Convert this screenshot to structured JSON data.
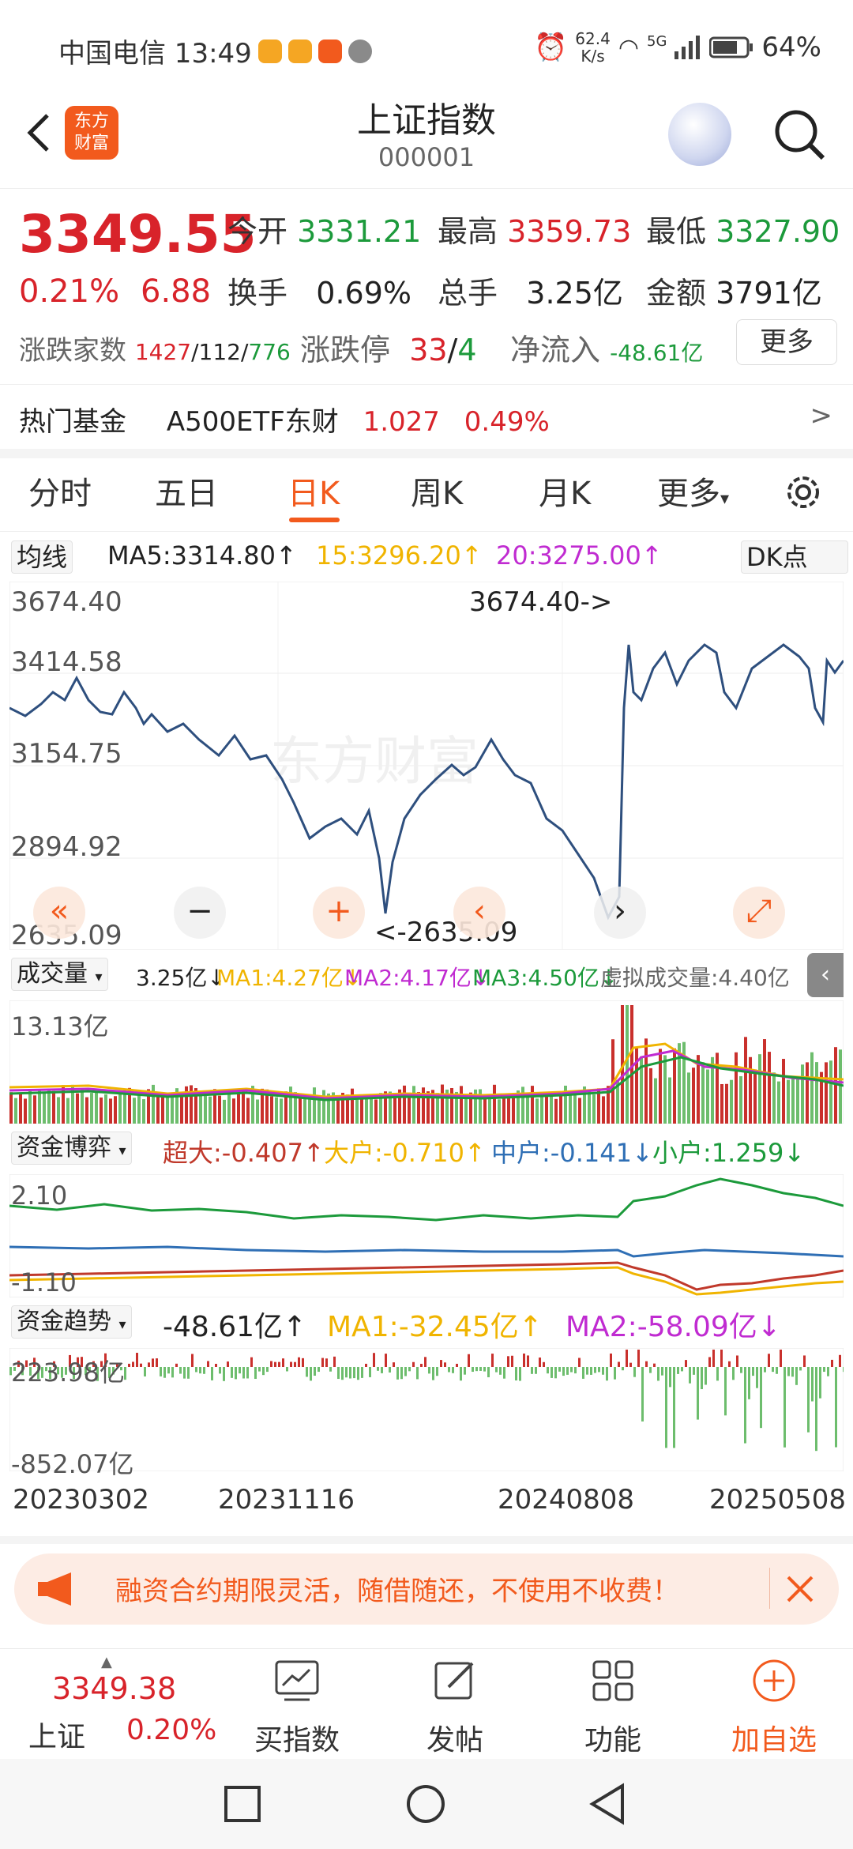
{
  "status_bar": {
    "carrier_time": "中国电信 13:49",
    "net_speed_value": "62.4",
    "net_speed_unit": "K/s",
    "signal": "5G",
    "battery": "64%"
  },
  "header": {
    "logo_line1": "东方",
    "logo_line2": "财富",
    "title": "上证指数",
    "code": "000001"
  },
  "quote": {
    "price": "3349.55",
    "change_pct": "0.21%",
    "change_val": "6.88",
    "open_label": "今开",
    "open": "3331.21",
    "high_label": "最高",
    "high": "3359.73",
    "low_label": "最低",
    "low": "3327.90",
    "turnover_label": "换手",
    "turnover": "0.69%",
    "volume_label": "总手",
    "volume": "3.25亿",
    "amount_label": "金额",
    "amount": "3791亿",
    "breadth_label": "涨跌家数",
    "breadth_up": "1427",
    "breadth_flat": "112",
    "breadth_down": "776",
    "limit_label": "涨跌停",
    "limit_up": "33",
    "limit_down": "4",
    "inflow_label": "净流入",
    "inflow": "-48.61亿",
    "more": "更多"
  },
  "hot_fund": {
    "label": "热门基金",
    "name": "A500ETF东财",
    "price": "1.027",
    "pct": "0.49%",
    "arrow": ">"
  },
  "tabs": [
    "分时",
    "五日",
    "日K",
    "周K",
    "月K",
    "更多"
  ],
  "active_tab": "日K",
  "kline": {
    "ma_selector": "均线",
    "ma5": "MA5:3314.80↑",
    "ma15": "15:3296.20↑",
    "ma20": "20:3275.00↑",
    "dk_button": "DK点",
    "y_ticks": [
      "3674.40",
      "3414.58",
      "3154.75",
      "2894.92",
      "2635.09"
    ],
    "max_label": "3674.40->",
    "min_label": "<-2635.09",
    "watermark": "东方财富"
  },
  "volume_panel": {
    "selector": "成交量",
    "value": "3.25亿↓",
    "ma1": "MA1:4.27亿↓",
    "ma2": "MA2:4.17亿↓",
    "ma3": "MA3:4.50亿↓",
    "virtual": "虚拟成交量:4.40亿",
    "max": "13.13亿"
  },
  "capital_game": {
    "selector": "资金博弈",
    "super": "超大:-0.407↑",
    "large": "大户:-0.710↑",
    "medium": "中户:-0.141↓",
    "small": "小户:1.259↓",
    "top": "2.10",
    "bottom": "-1.10"
  },
  "capital_trend": {
    "selector": "资金趋势",
    "value": "-48.61亿↑",
    "ma1": "MA1:-32.45亿↑",
    "ma2": "MA2:-58.09亿↓",
    "top": "223.98亿",
    "bottom": "-852.07亿"
  },
  "x_dates": [
    "20230302",
    "20231116",
    "20240808",
    "20250508"
  ],
  "promo": {
    "text": "融资合约期限灵活，随借随还，不使用不收费！"
  },
  "bottom_bar": {
    "index_value": "3349.38",
    "index_name": "上证",
    "index_pct": "0.20%",
    "buy": "买指数",
    "post": "发帖",
    "func": "功能",
    "add": "加自选"
  },
  "colors": {
    "accent": "#f25a1d",
    "up": "#d8232a",
    "down": "#1c9a3b",
    "line": "#2e4f7e"
  }
}
